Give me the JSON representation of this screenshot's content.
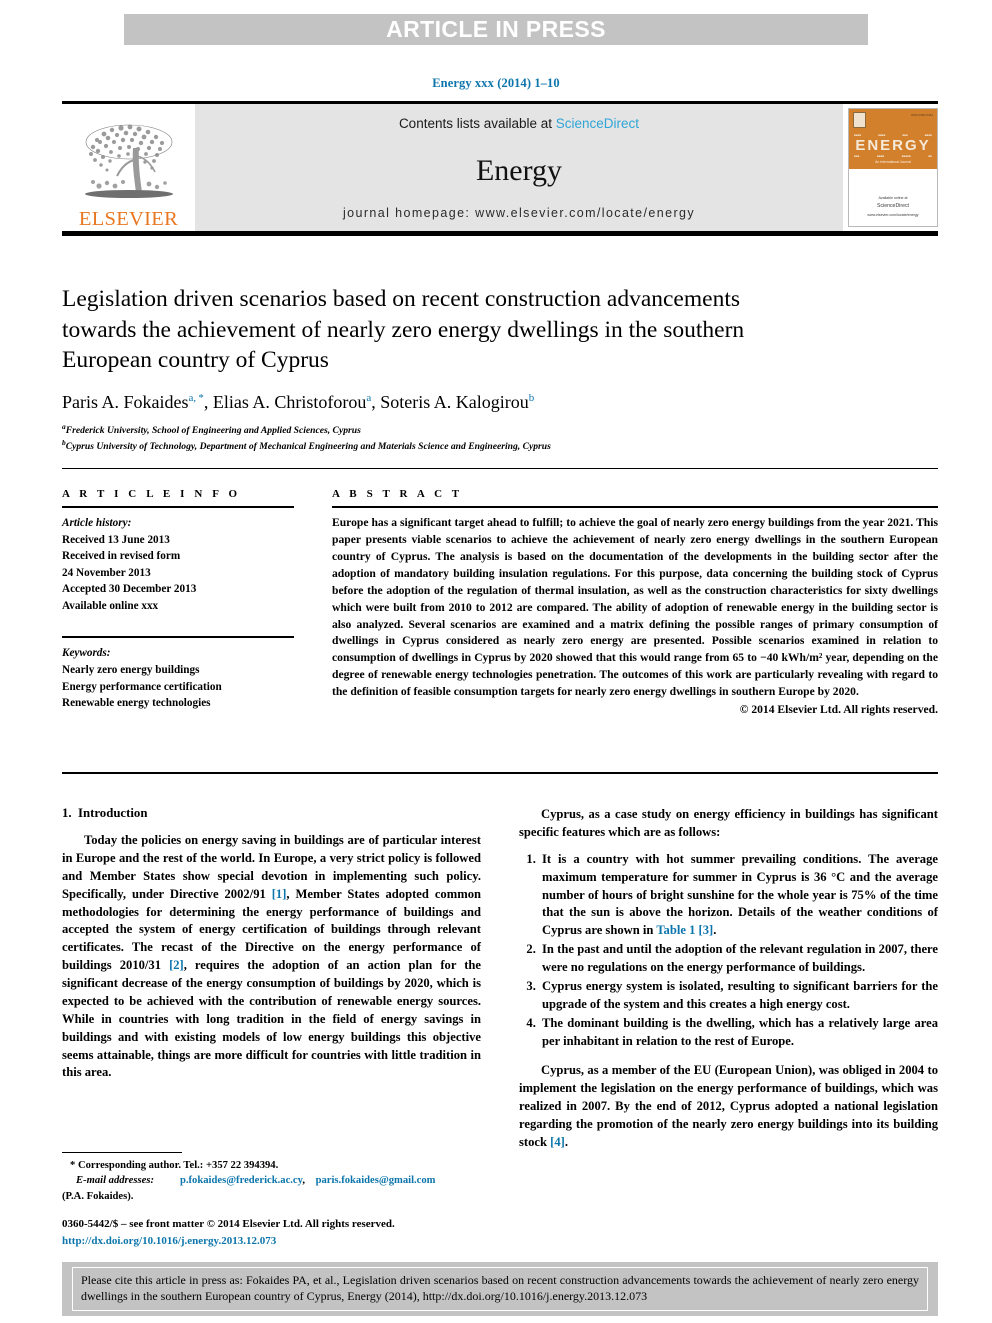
{
  "banner": {
    "label": "ARTICLE IN PRESS"
  },
  "journal_ref": "Energy xxx (2014) 1–10",
  "masthead": {
    "publisher": "ELSEVIER",
    "contents_prefix": "Contents lists available at ",
    "contents_link": "ScienceDirect",
    "journal_title": "Energy",
    "homepage": "journal homepage: www.elsevier.com/locate/energy",
    "cover": {
      "energy_word": "ENERGY",
      "tagline": "An International Journal",
      "publisher_small": "ELSEVIER",
      "foot_line1": "Available online at",
      "foot_line2": "ScienceDirect",
      "foot_line3": "www.elsevier.com/locate/energy",
      "topright": "ISSN 0360-5442"
    }
  },
  "article": {
    "title": "Legislation driven scenarios based on recent construction advancements towards the achievement of nearly zero energy dwellings in the southern European country of Cyprus",
    "authors_html": "Paris A. Fokaides<sup>a, *</sup>, Elias A. Christoforou<sup>a</sup>, Soteris A. Kalogirou<sup>b</sup>",
    "affiliation_a": "Frederick University, School of Engineering and Applied Sciences, Cyprus",
    "affiliation_b": "Cyprus University of Technology, Department of Mechanical Engineering and Materials Science and Engineering, Cyprus"
  },
  "article_info": {
    "heading": "A R T I C L E   I N F O",
    "history_label": "Article history:",
    "history": [
      "Received 13 June 2013",
      "Received in revised form",
      "24 November 2013",
      "Accepted 30 December 2013",
      "Available online xxx"
    ],
    "keywords_label": "Keywords:",
    "keywords": [
      "Nearly zero energy buildings",
      "Energy performance certification",
      "Renewable energy technologies"
    ]
  },
  "abstract": {
    "heading": "A B S T R A C T",
    "text": "Europe has a significant target ahead to fulfill; to achieve the goal of nearly zero energy buildings from the year 2021. This paper presents viable scenarios to achieve the achievement of nearly zero energy dwellings in the southern European country of Cyprus. The analysis is based on the documentation of the developments in the building sector after the adoption of mandatory building insulation regulations. For this purpose, data concerning the building stock of Cyprus before the adoption of the regulation of thermal insulation, as well as the construction characteristics for sixty dwellings which were built from 2010 to 2012 are compared. The ability of adoption of renewable energy in the building sector is also analyzed. Several scenarios are examined and a matrix defining the possible ranges of primary consumption of dwellings in Cyprus considered as nearly zero energy are presented. Possible scenarios examined in relation to consumption of dwellings in Cyprus by 2020 showed that this would range from 65 to −40 kWh/m² year, depending on the degree of renewable energy technologies penetration. The outcomes of this work are particularly revealing with regard to the definition of feasible consumption targets for nearly zero energy dwellings in southern Europe by 2020.",
    "copyright": "© 2014 Elsevier Ltd. All rights reserved."
  },
  "introduction": {
    "section_number_title": "1. Introduction",
    "para1_part1": "Today the policies on energy saving in buildings are of particular interest in Europe and the rest of the world. In Europe, a very strict policy is followed and Member States show special devotion in implementing such policy. Specifically, under Directive 2002/91 ",
    "para1_ref1": "[1]",
    "para1_part2": ", Member States adopted common methodologies for determining the energy performance of buildings and accepted the system of energy certification of buildings through relevant certificates. The recast of the Directive on the energy performance of buildings 2010/31 ",
    "para1_ref2": "[2]",
    "para1_part3": ", requires the adoption of an action plan for the significant decrease of the energy consumption of buildings by 2020, which is expected to be achieved with the contribution of renewable energy sources. While in countries with long tradition in the field of energy savings in buildings and with existing models of low energy buildings this objective seems attainable, things are more difficult for countries with little tradition in this area.",
    "para2": "Cyprus, as a case study on energy efficiency in buildings has significant specific features which are as follows:",
    "list": [
      {
        "text_before": "It is a country with hot summer prevailing conditions. The average maximum temperature for summer in Cyprus is 36 °C and the average number of hours of bright sunshine for the whole year is 75% of the time that the sun is above the horizon. Details of the weather conditions of Cyprus are shown in ",
        "link": "Table 1 [3]",
        "text_after": "."
      },
      {
        "text_before": "In the past and until the adoption of the relevant regulation in 2007, there were no regulations on the energy performance of buildings.",
        "link": "",
        "text_after": ""
      },
      {
        "text_before": "Cyprus energy system is isolated, resulting to significant barriers for the upgrade of the system and this creates a high energy cost.",
        "link": "",
        "text_after": ""
      },
      {
        "text_before": "The dominant building is the dwelling, which has a relatively large area per inhabitant in relation to the rest of Europe.",
        "link": "",
        "text_after": ""
      }
    ],
    "para3_part1": "Cyprus, as a member of the EU (European Union), was obliged in 2004 to implement the legislation on the energy performance of buildings, which was realized in 2007. By the end of 2012, Cyprus adopted a national legislation regarding the promotion of the nearly zero energy buildings into its building stock ",
    "para3_ref": "[4]",
    "para3_part2": "."
  },
  "footnote": {
    "corresponding": "* Corresponding author. Tel.: +357 22 394394.",
    "email_label": "E-mail addresses:",
    "email1": "p.fokaides@frederick.ac.cy",
    "email1_sep": ",",
    "email2": "paris.fokaides@gmail.com",
    "email_owner": "(P.A. Fokaides).",
    "issn_line": "0360-5442/$ – see front matter © 2014 Elsevier Ltd. All rights reserved.",
    "doi_line": "http://dx.doi.org/10.1016/j.energy.2013.12.073"
  },
  "cite_box": {
    "text": "Please cite this article in press as: Fokaides PA, et al., Legislation driven scenarios based on recent construction advancements towards the achievement of nearly zero energy dwellings in the southern European country of Cyprus, Energy (2014), http://dx.doi.org/10.1016/j.energy.2013.12.073"
  },
  "colors": {
    "link_blue": "#0c75ac",
    "sciencedirect_blue": "#2fa5d6",
    "elsevier_orange": "#e87722",
    "banner_gray": "#c3c3c3",
    "masthead_gray": "#e4e4e4"
  }
}
